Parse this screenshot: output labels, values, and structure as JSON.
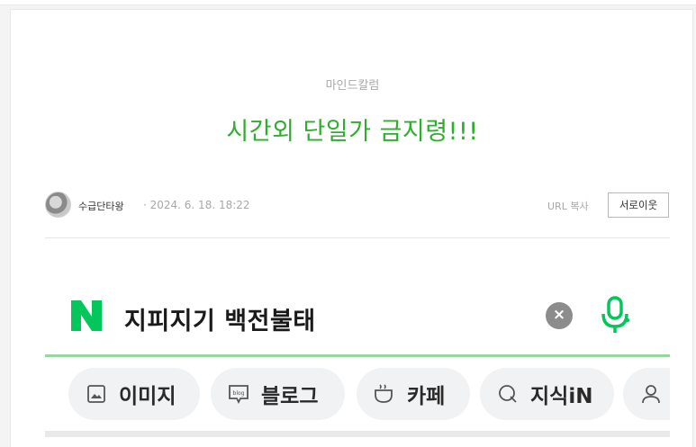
{
  "post": {
    "category": "마인드칼럼",
    "title": "시간외 단일가 금지령!!!",
    "author": "수급단타왕",
    "date": "· 2024. 6. 18. 18:22",
    "url_copy_label": "URL 복사",
    "neighbor_label": "서로이웃"
  },
  "embedded_screenshot": {
    "logo": "naver-n-logo",
    "search_query": "지피지기 백전불태",
    "clear_icon": "close-icon",
    "mic_icon": "microphone-icon",
    "tabs": [
      {
        "label": "이미지",
        "icon": "image-icon"
      },
      {
        "label": "블로그",
        "icon": "blog-icon"
      },
      {
        "label": "카페",
        "icon": "cafe-cup-icon"
      },
      {
        "label": "지식iN",
        "icon": "knowledge-icon"
      },
      {
        "label": "",
        "icon": "person-icon"
      }
    ]
  },
  "colors": {
    "title_green": "#2fad2f",
    "naver_green": "#03c75a",
    "search_underline": "#9ad6a1"
  }
}
